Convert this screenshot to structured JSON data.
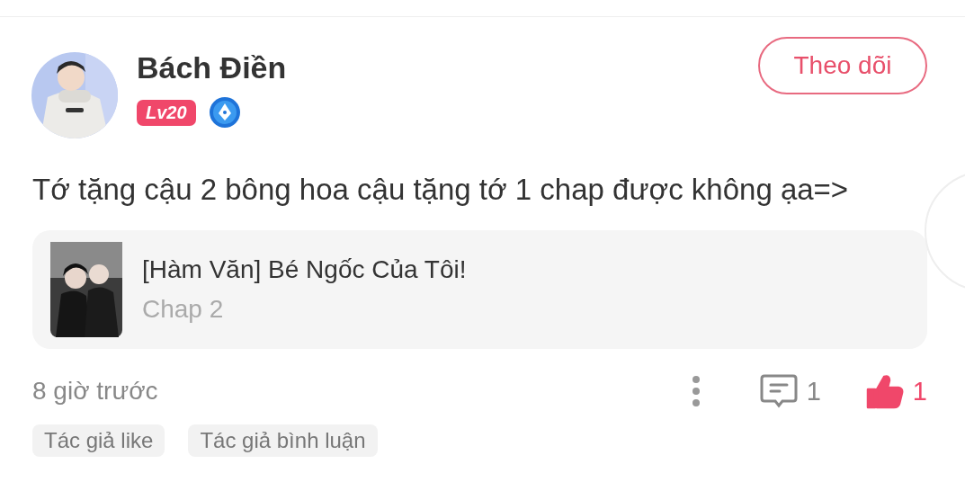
{
  "comment": {
    "author": "Bách Điền",
    "level_badge": "Lv20",
    "follow_button": "Theo dõi",
    "text": "Tớ tặng cậu 2 bông hoa cậu tặng tớ 1 chap được không ạa=>",
    "story": {
      "title": "[Hàm Văn] Bé Ngốc Của Tôi!",
      "chapter": "Chap 2"
    },
    "time": "8 giờ trước",
    "reply_count": "1",
    "like_count": "1",
    "liked": true,
    "tags": [
      "Tác giả like",
      "Tác giả bình luận"
    ]
  }
}
